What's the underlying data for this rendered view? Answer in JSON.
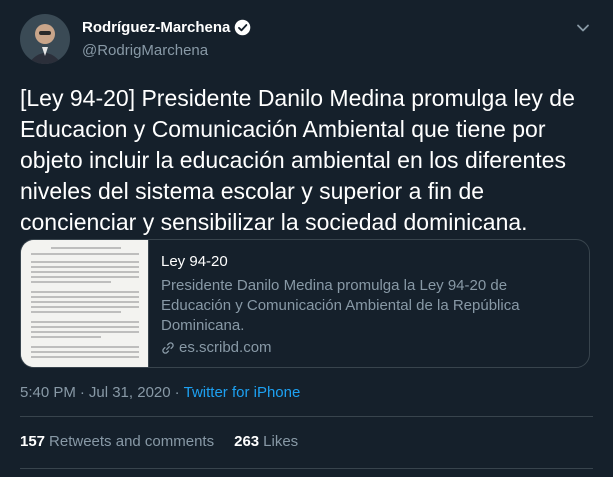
{
  "author": {
    "name": "Rodríguez-Marchena",
    "handle": "@RodrigMarchena",
    "verified": true
  },
  "tweet": {
    "text": "[Ley 94-20] Presidente Danilo Medina promulga ley de Educacion y Comunicación Ambiental que tiene por objeto incluir la educación ambiental en los diferentes niveles del sistema escolar y superior a fin de concienciar y sensibilizar la sociedad dominicana.",
    "time": "5:40 PM",
    "date": "Jul 31, 2020",
    "separator": "·",
    "source": "Twitter for iPhone"
  },
  "card": {
    "title": "Ley 94-20",
    "description": "Presidente Danilo Medina promulga la Ley 94-20 de Educación y Comunicación Ambiental de la República Dominicana.",
    "domain": "es.scribd.com"
  },
  "stats": {
    "retweets_count": "157",
    "retweets_label": "Retweets and comments",
    "likes_count": "263",
    "likes_label": "Likes"
  },
  "colors": {
    "background": "#15202b",
    "accent": "#1da1f2",
    "muted": "#8899a6",
    "border": "#38444d"
  }
}
